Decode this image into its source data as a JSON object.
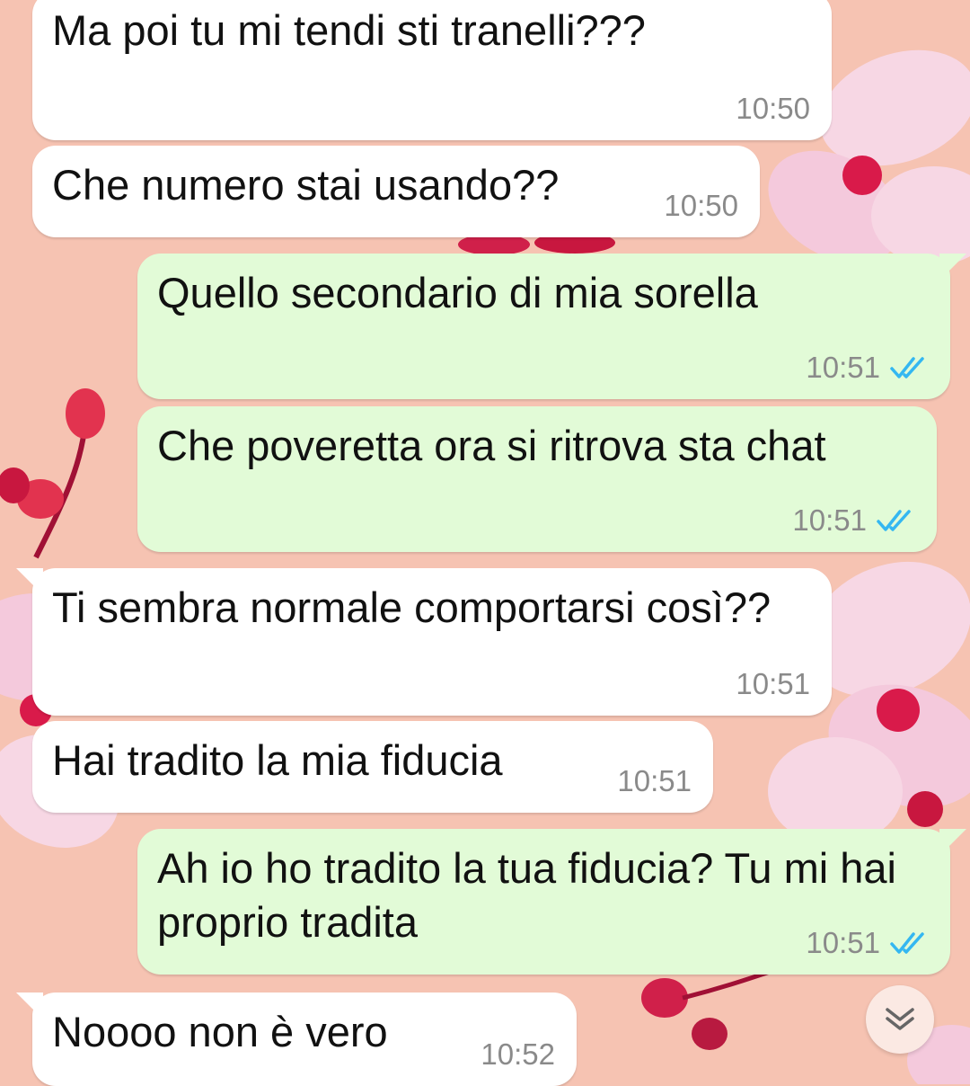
{
  "colors": {
    "wallpaper": "#f6c3b2",
    "incoming_bubble": "#ffffff",
    "outgoing_bubble": "#e2fbd7",
    "read_ticks": "#34b7f1",
    "timestamp": "#8a8a8a"
  },
  "messages": [
    {
      "direction": "incoming",
      "text": "Ma poi tu mi tendi sti tranelli???",
      "time": "10:50"
    },
    {
      "direction": "incoming",
      "text": "Che numero stai usando??",
      "time": "10:50"
    },
    {
      "direction": "outgoing",
      "text": "Quello secondario di mia sorella",
      "time": "10:51",
      "status": "read"
    },
    {
      "direction": "outgoing",
      "text": "Che poveretta ora si ritrova sta chat",
      "time": "10:51",
      "status": "read"
    },
    {
      "direction": "incoming",
      "text": "Ti sembra normale comportarsi così??",
      "time": "10:51"
    },
    {
      "direction": "incoming",
      "text": "Hai tradito la mia fiducia",
      "time": "10:51"
    },
    {
      "direction": "outgoing",
      "text": "Ah io ho tradito la tua fiducia? Tu mi hai proprio tradita",
      "time": "10:51",
      "status": "read"
    },
    {
      "direction": "incoming",
      "text": "Noooo non è vero",
      "time": "10:52"
    }
  ],
  "scroll_button": {
    "icon": "double-chevron-down-icon"
  },
  "wallpaper": {
    "icon": "cherry-blossom-wallpaper"
  }
}
